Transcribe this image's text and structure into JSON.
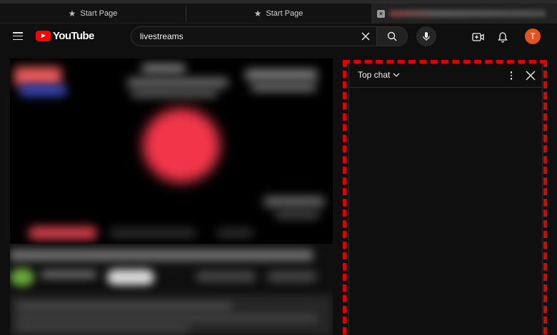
{
  "browser": {
    "tabs": [
      {
        "label": "Start Page",
        "icon": "star-icon"
      },
      {
        "label": "Start Page",
        "icon": "star-icon"
      },
      {
        "label": "",
        "icon": "close-icon"
      }
    ]
  },
  "header": {
    "logo_text": "YouTube",
    "search": {
      "value": "livestreams",
      "placeholder": "Search"
    },
    "avatar_letter": "T",
    "colors": {
      "brand": "#ff0000",
      "avatar": "#e3531e"
    }
  },
  "chat": {
    "title": "Top chat",
    "highlight_color": "#e00000"
  }
}
